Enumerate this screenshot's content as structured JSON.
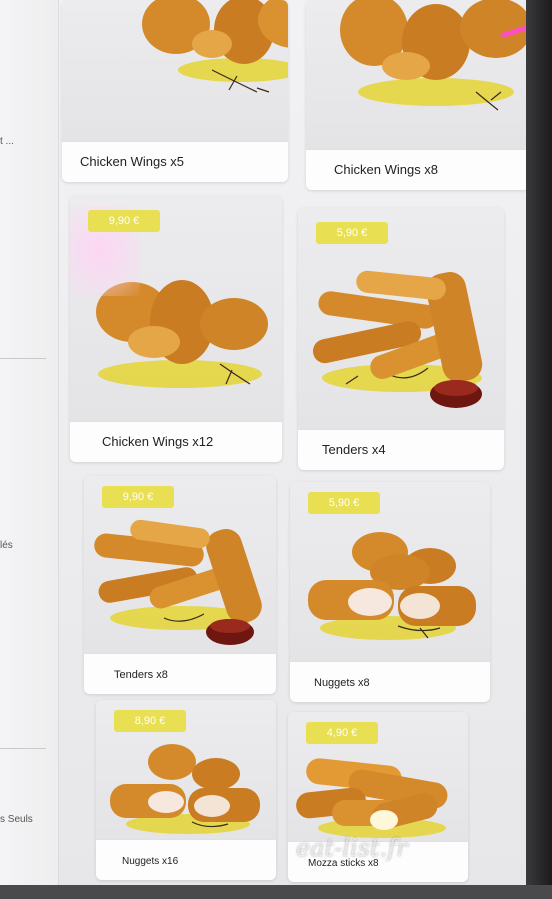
{
  "sidebar": {
    "items": [
      "t ...",
      "lés",
      "s Seuls"
    ]
  },
  "products": [
    {
      "name": "Chicken Wings x5",
      "price": "",
      "icon": "chicken-wings-icon"
    },
    {
      "name": "Chicken Wings x8",
      "price": "",
      "icon": "chicken-wings-icon"
    },
    {
      "name": "Chicken Wings x12",
      "price": "9,90 €",
      "icon": "chicken-wings-icon"
    },
    {
      "name": "Tenders x4",
      "price": "5,90 €",
      "icon": "tenders-icon"
    },
    {
      "name": "Tenders x8",
      "price": "9,90 €",
      "icon": "tenders-icon"
    },
    {
      "name": "Nuggets x8",
      "price": "5,90 €",
      "icon": "nuggets-icon"
    },
    {
      "name": "Nuggets x16",
      "price": "8,90 €",
      "icon": "nuggets-icon"
    },
    {
      "name": "Mozza sticks x8",
      "price": "4,90 €",
      "icon": "mozza-sticks-icon"
    }
  ],
  "watermark": "eat-list.fr",
  "colors": {
    "price_badge": "#e8df52",
    "sauce": "#7a1c16",
    "fried": "#d98a2b"
  }
}
